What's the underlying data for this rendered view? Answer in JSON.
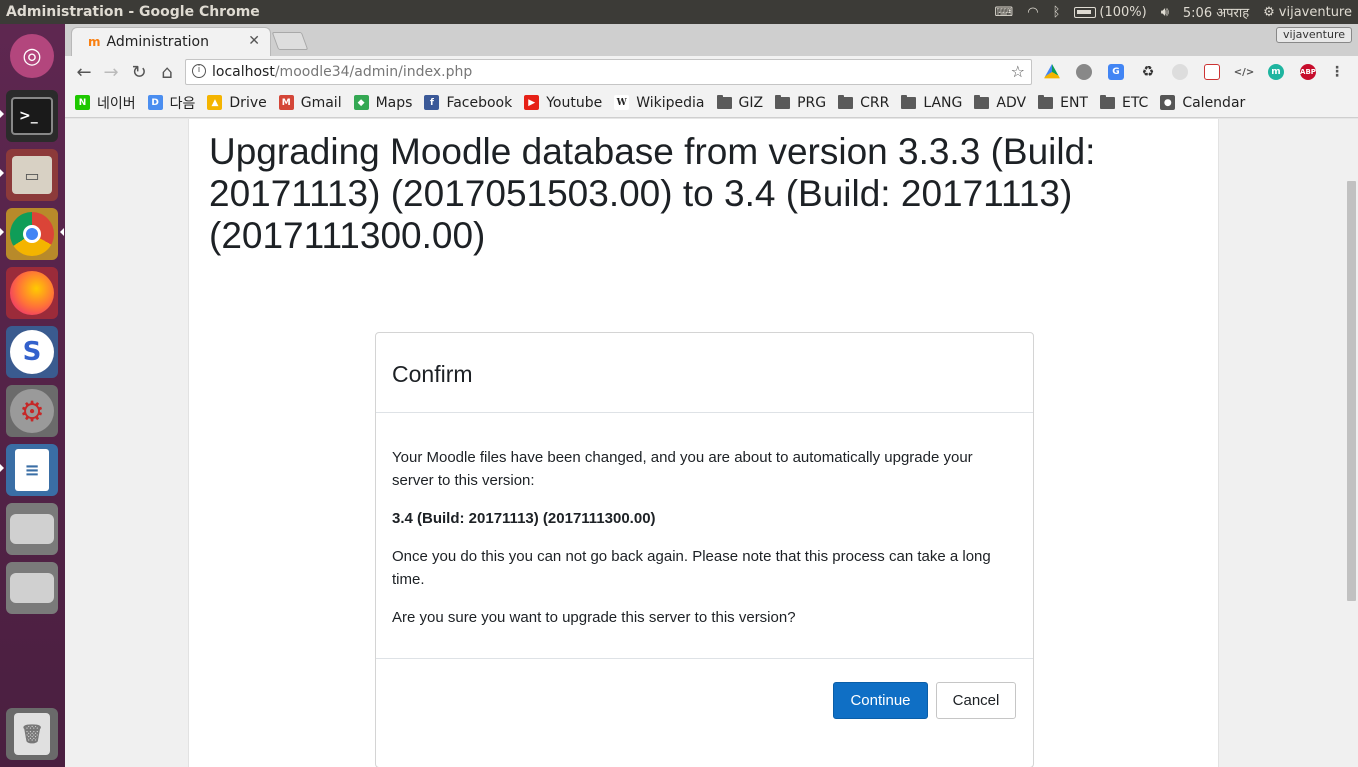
{
  "system_bar": {
    "window_title": "Administration - Google Chrome",
    "battery": "(100%)",
    "time": "5:06 अपराह",
    "user": "vijaventure"
  },
  "launcher": {
    "apps": [
      "ubuntu-dash-icon",
      "terminal-icon",
      "files-icon",
      "chrome-icon",
      "firefox-icon",
      "simplenote-icon",
      "settings-icon",
      "writer-icon",
      "drive-icon",
      "drive-icon",
      "trash-icon"
    ]
  },
  "browser": {
    "tab": {
      "title": "Administration",
      "favicon": "m",
      "close": "✕"
    },
    "profile_badge": "vijaventure",
    "url_host": "localhost",
    "url_path": "/moodle34/admin/index.php",
    "nav": {
      "back": "←",
      "forward": "→",
      "reload": "↻",
      "home": "⌂",
      "star": "☆"
    },
    "bookmarks": [
      {
        "label": "네이버",
        "icon": "naver-icon",
        "badge": "N",
        "color": "#1ec800"
      },
      {
        "label": "다음",
        "icon": "daum-icon",
        "badge": "D",
        "color": "#4b8ef0"
      },
      {
        "label": "Drive",
        "icon": "drive-icon",
        "badge": "▲",
        "color": "#f4b400"
      },
      {
        "label": "Gmail",
        "icon": "gmail-icon",
        "badge": "M",
        "color": "#d44638"
      },
      {
        "label": "Maps",
        "icon": "maps-icon",
        "badge": "◆",
        "color": "#34a853"
      },
      {
        "label": "Facebook",
        "icon": "facebook-icon",
        "badge": "f",
        "color": "#3b5998"
      },
      {
        "label": "Youtube",
        "icon": "youtube-icon",
        "badge": "▶",
        "color": "#e62117"
      },
      {
        "label": "Wikipedia",
        "icon": "wikipedia-icon",
        "badge": "W",
        "color": "#ffffff"
      },
      {
        "label": "GIZ",
        "icon": "folder-icon",
        "folder": true
      },
      {
        "label": "PRG",
        "icon": "folder-icon",
        "folder": true
      },
      {
        "label": "CRR",
        "icon": "folder-icon",
        "folder": true
      },
      {
        "label": "LANG",
        "icon": "folder-icon",
        "folder": true
      },
      {
        "label": "ADV",
        "icon": "folder-icon",
        "folder": true
      },
      {
        "label": "ENT",
        "icon": "folder-icon",
        "folder": true
      },
      {
        "label": "ETC",
        "icon": "folder-icon",
        "folder": true
      },
      {
        "label": "Calendar",
        "icon": "apple-icon",
        "badge": "●",
        "color": "#555555"
      }
    ]
  },
  "page": {
    "heading": "Upgrading Moodle database from version 3.3.3 (Build: 20171113) (2017051503.00) to 3.4 (Build: 20171113) (2017111300.00)",
    "confirm": {
      "title": "Confirm",
      "message1": "Your Moodle files have been changed, and you are about to automatically upgrade your server to this version:",
      "version": "3.4 (Build: 20171113) (2017111300.00)",
      "message2": "Once you do this you can not go back again. Please note that this process can take a long time.",
      "question": "Are you sure you want to upgrade this server to this version?",
      "continue_label": "Continue",
      "cancel_label": "Cancel"
    }
  },
  "colors": {
    "primary": "#0f6fc5",
    "launcher": "#5e2750"
  }
}
